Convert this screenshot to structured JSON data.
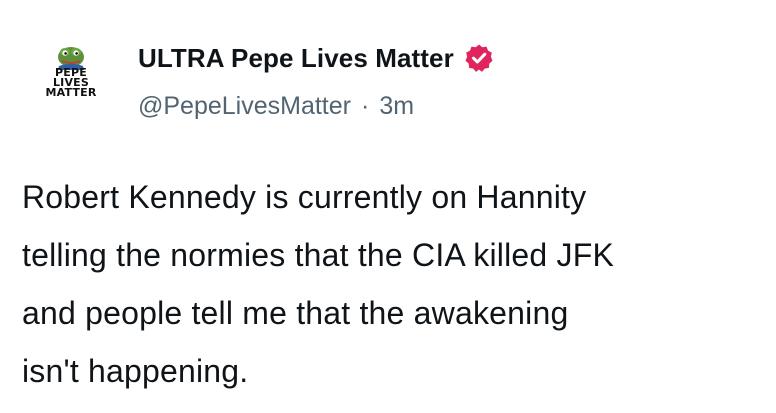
{
  "post": {
    "avatar": {
      "logo_text": "PEPE\nLIVES\nMATTER",
      "icon": "pepe-frog-logo"
    },
    "author": {
      "display_name": "ULTRA Pepe Lives Matter",
      "handle": "@PepeLivesMatter",
      "separator": "·",
      "time": "3m",
      "verified": true,
      "verified_color": "#e0245e"
    },
    "text_lines": [
      "Robert Kennedy is currently on Hannity",
      "telling the normies that the CIA killed JFK",
      "and people tell me that the awakening",
      "isn't happening."
    ]
  }
}
